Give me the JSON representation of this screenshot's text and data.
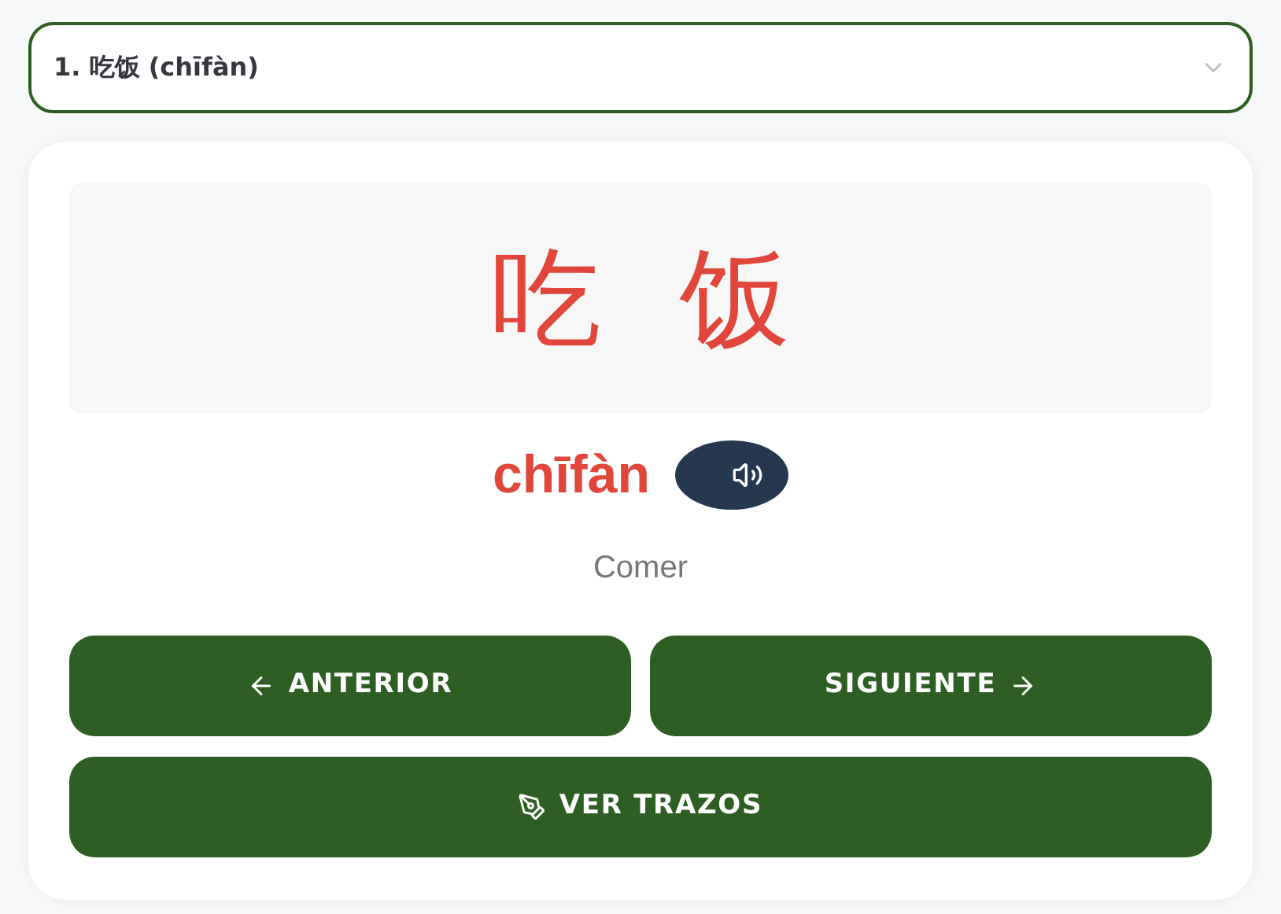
{
  "word_select": {
    "value": "1. 吃饭 (chīfàn)"
  },
  "characters": [
    "吃",
    "饭"
  ],
  "pinyin": "chīfàn",
  "meaning": "Comer",
  "nav_buttons": [
    {
      "kind": "previous",
      "label": "ANTERIOR"
    },
    {
      "kind": "next",
      "label": "SIGUIENTE"
    }
  ],
  "strokes_button": {
    "label": "VER TRAZOS"
  }
}
